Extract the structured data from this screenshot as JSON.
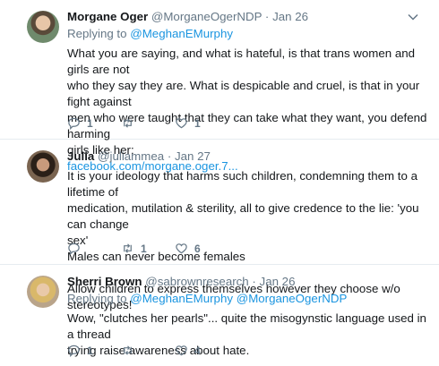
{
  "tweets": [
    {
      "name": "Morgane Oger",
      "handle": "@MorganeOgerNDP",
      "date": "Jan 26",
      "replying_prefix": "Replying to",
      "replying_to": [
        "@MeghanEMurphy"
      ],
      "body_lines": [
        "What you are saying, and what is hateful, is that trans women and girls are not",
        "who they say they are. What is despicable and cruel, is that in your fight against",
        "men who were taught that they can take what they want, you defend harming",
        "girls like her:"
      ],
      "link": "facebook.com/morgane.oger.7...",
      "replies": "1",
      "retweets": "",
      "likes": "1"
    },
    {
      "name": "Julia",
      "handle": "@juliammea",
      "date": "Jan 27",
      "body_lines": [
        "It is your ideology that harms such children, condemning them to a lifetime of",
        "medication, mutilation & sterility, all to give credence to the lie: 'you can change",
        "sex'",
        "Males can never become females",
        "",
        "Allow children to express themselves however they choose w/o stereotypes!"
      ],
      "replies": "",
      "retweets": "1",
      "likes": "6"
    },
    {
      "name": "Sherri Brown",
      "handle": "@sabrownresearch",
      "date": "Jan 26",
      "replying_prefix": "Replying to",
      "replying_to": [
        "@MeghanEMurphy",
        "@MorganeOgerNDP"
      ],
      "body_lines": [
        "Wow, \"clutches her pearls\"... quite the misogynstic language used in a thread",
        "trying raise awareness about hate."
      ],
      "replies": "1",
      "retweets": "",
      "likes": "4"
    }
  ],
  "separator": "·",
  "icons": [
    "avatar",
    "chevron-down-icon",
    "reply-icon",
    "retweet-icon",
    "like-icon"
  ],
  "colors": {
    "link": "#1b95e0",
    "muted": "#657786",
    "text": "#14171a",
    "divider": "#e6ecf0"
  }
}
